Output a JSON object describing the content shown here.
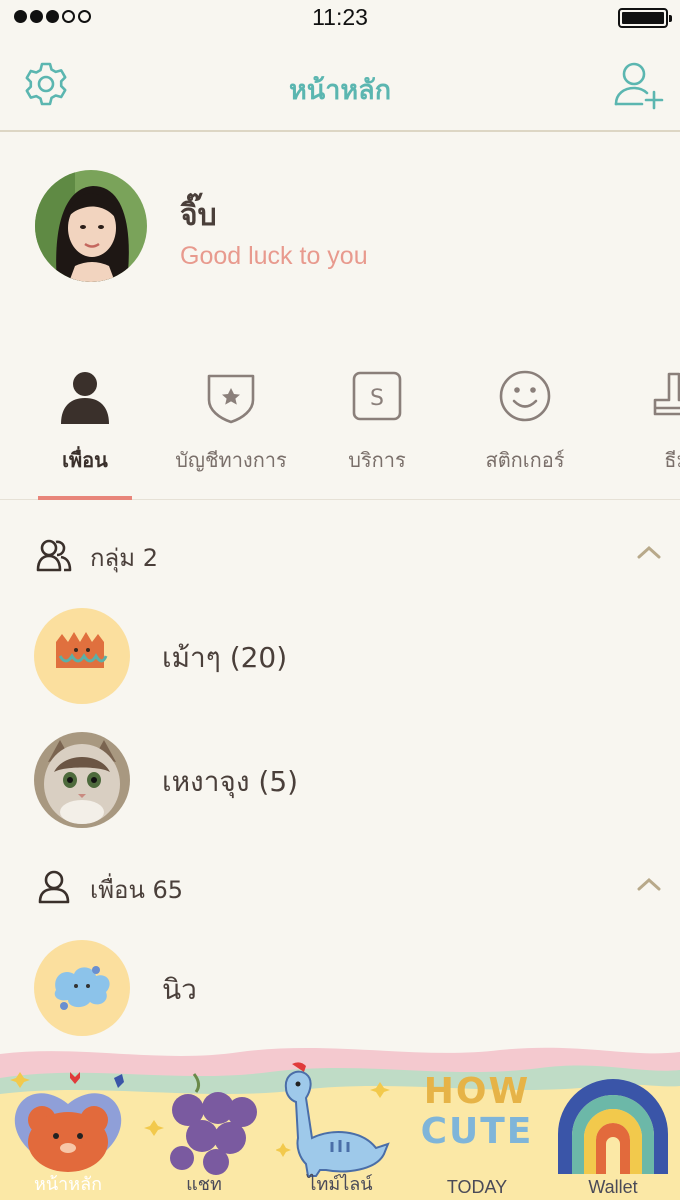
{
  "status_bar": {
    "time": "11:23"
  },
  "nav": {
    "title": "หน้าหลัก"
  },
  "profile": {
    "name": "จิ๊บ",
    "status": "Good luck to you"
  },
  "tabs": [
    {
      "label": "เพื่อน",
      "icon": "person-icon"
    },
    {
      "label": "บัญชีทางการ",
      "icon": "shield-star-icon"
    },
    {
      "label": "บริการ",
      "icon": "service-s-icon"
    },
    {
      "label": "สติกเกอร์",
      "icon": "smiley-icon"
    },
    {
      "label": "ธีม",
      "icon": "brush-icon"
    }
  ],
  "groups_section": {
    "title": "กลุ่ม 2",
    "items": [
      {
        "name": "เม้าๆ (20)"
      },
      {
        "name": "เหงาจุง (5)"
      }
    ]
  },
  "friends_section": {
    "title": "เพื่อน 65",
    "items": [
      {
        "name": "นิว"
      }
    ]
  },
  "tab_bar": {
    "items": [
      {
        "label": "หน้าหลัก",
        "icon": "bear-face-icon"
      },
      {
        "label": "แชท",
        "icon": "grapes-icon"
      },
      {
        "label": "ไทม์ไลน์",
        "icon": "dinosaur-icon"
      },
      {
        "label": "TODAY",
        "icon": "how-cute-text-icon"
      },
      {
        "label": "Wallet",
        "icon": "rainbow-icon"
      }
    ],
    "art_text": [
      "HOW",
      "CUTE"
    ]
  },
  "colors": {
    "accent_teal": "#5bb6b0",
    "status_pink": "#e89a8e",
    "tab_underline": "#e8857a",
    "background": "#f8f6f0"
  }
}
